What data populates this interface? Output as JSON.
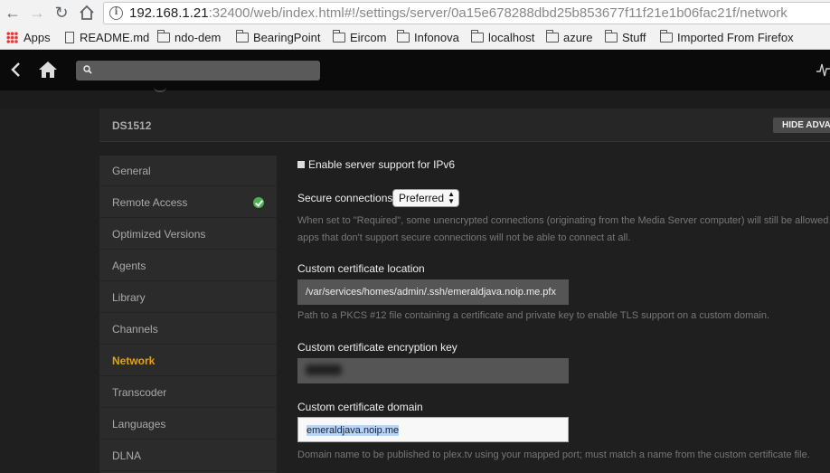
{
  "browser": {
    "url_host": "192.168.1.21",
    "url_rest": ":32400/web/index.html#!/settings/server/0a15e678288dbd25b853677f11f21e1b06fac21f/network",
    "bookmarks": [
      "Apps",
      "README.md",
      "ndo-dem",
      "BearingPoint",
      "Eircom",
      "Infonova",
      "localhost",
      "azure",
      "Stuff",
      "Imported From Firefox"
    ]
  },
  "header": {
    "server_name": "DS1512",
    "hide_advanced_label": "HIDE ADVANCED"
  },
  "search": {
    "placeholder": ""
  },
  "sidebar": {
    "items": [
      {
        "label": "General"
      },
      {
        "label": "Remote Access",
        "status": "check-icon"
      },
      {
        "label": "Optimized Versions"
      },
      {
        "label": "Agents"
      },
      {
        "label": "Library"
      },
      {
        "label": "Channels"
      },
      {
        "label": "Network",
        "active": true
      },
      {
        "label": "Transcoder"
      },
      {
        "label": "Languages"
      },
      {
        "label": "DLNA"
      }
    ]
  },
  "settings": {
    "ipv6_label": "Enable server support for IPv6",
    "secure_label": "Secure connections",
    "secure_value": "Preferred",
    "secure_help_1": "When set to \"Required\", some unencrypted connections (originating from the Media Server computer) will still be allowed",
    "secure_help_2": "apps that don't support secure connections will not be able to connect at all.",
    "cert_location_label": "Custom certificate location",
    "cert_location_value": "/var/services/homes/admin/.ssh/emeraldjava.noip.me.pfx",
    "cert_location_help": "Path to a PKCS #12 file containing a certificate and private key to enable TLS support on a custom domain.",
    "cert_key_label": "Custom certificate encryption key",
    "cert_domain_label": "Custom certificate domain",
    "cert_domain_value": "emeraldjava.noip.me",
    "cert_domain_help": "Domain name to be published to plex.tv using your mapped port; must match a name from the custom certificate file."
  },
  "colors": {
    "accent": "#e5a00d",
    "success": "#4caf50"
  }
}
